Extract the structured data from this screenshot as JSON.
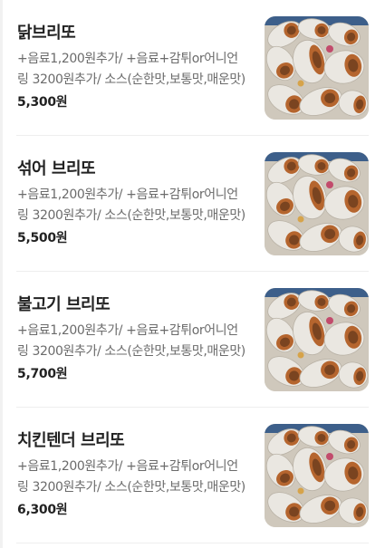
{
  "menu": {
    "items": [
      {
        "name": "닭브리또",
        "description": "+음료1,200원추가/ +음료+감튀or어니언링 3200원추가/ 소스(순한맛,보통맛,매운맛)",
        "price": "5,300원",
        "image_icon": "burrito-photo"
      },
      {
        "name": "섞어 브리또",
        "description": "+음료1,200원추가/ +음료+감튀or어니언링 3200원추가/ 소스(순한맛,보통맛,매운맛)",
        "price": "5,500원",
        "image_icon": "burrito-photo"
      },
      {
        "name": "불고기 브리또",
        "description": "+음료1,200원추가/ +음료+감튀or어니언링 3200원추가/ 소스(순한맛,보통맛,매운맛)",
        "price": "5,700원",
        "image_icon": "burrito-photo"
      },
      {
        "name": "치킨텐더 브리또",
        "description": "+음료1,200원추가/ +음료+감튀or어니언링 3200원추가/ 소스(순한맛,보통맛,매운맛)",
        "price": "6,300원",
        "image_icon": "burrito-photo"
      }
    ]
  },
  "colors": {
    "name_text": "#222222",
    "desc_text": "#6b6b6b",
    "divider": "#eeeeee"
  }
}
